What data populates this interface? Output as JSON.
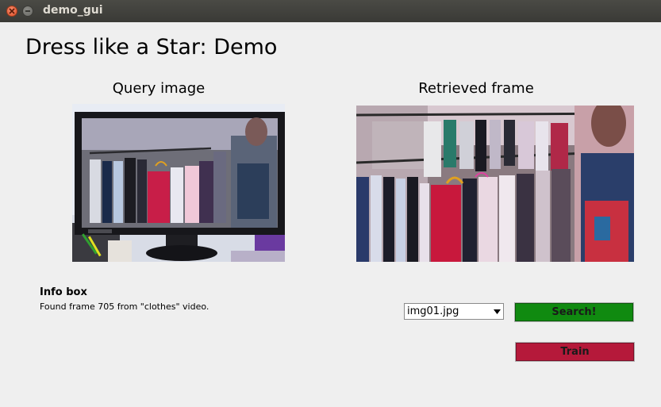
{
  "window": {
    "title": "demo_gui"
  },
  "app": {
    "title": "Dress like a Star: Demo"
  },
  "query": {
    "label": "Query image"
  },
  "retrieved": {
    "label": "Retrieved frame"
  },
  "info": {
    "title": "Info box",
    "text": "Found frame 705 from \"clothes\" video."
  },
  "controls": {
    "image_select": {
      "selected": "img01.jpg"
    },
    "search_label": "Search!",
    "train_label": "Train",
    "search_color": "#108a10",
    "train_color": "#b5193a"
  },
  "icons": [
    "close-icon",
    "minimize-icon",
    "chevron-down-icon"
  ]
}
